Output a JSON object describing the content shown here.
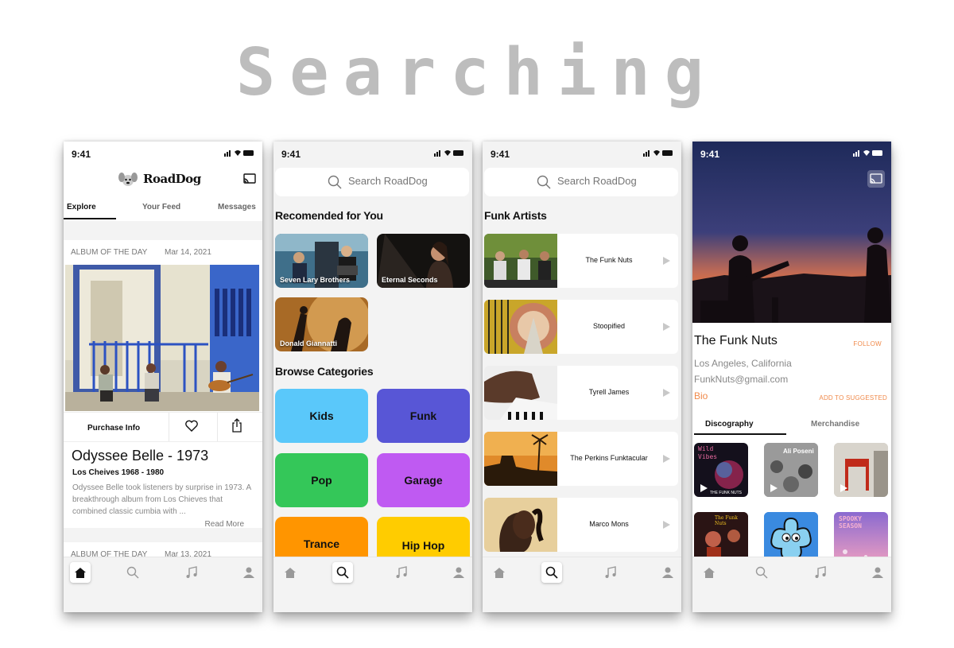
{
  "page_title": "Searching",
  "status": {
    "time": "9:41",
    "icons": "▐▐ ▾ ▬"
  },
  "nav": {
    "home": "home-icon",
    "search": "search-icon",
    "music": "music-note-icon",
    "profile": "profile-icon"
  },
  "explore": {
    "app_name": "RoadDog",
    "tabs": [
      "Explore",
      "Your Feed",
      "Messages"
    ],
    "card": {
      "label": "ALBUM OF THE DAY",
      "date": "Mar 14, 2021",
      "purchase": "Purchase Info",
      "album_title": "Odyssee Belle  - 1973",
      "artist_line": "Los Cheives  1968 - 1980",
      "description": "Odyssee Belle took listeners by surprise in 1973. A breakthrough album from Los Chieves that combined classic cumbia with ...",
      "read_more": "Read More"
    },
    "next_card": {
      "label": "ALBUM OF THE DAY",
      "date": "Mar 13, 2021"
    }
  },
  "search": {
    "placeholder": "Search RoadDog",
    "recommended_heading": "Recomended for You",
    "recommended": [
      "Seven Lary Brothers",
      "Eternal Seconds",
      "Donald Giannatti"
    ],
    "categories_heading": "Browse Categories",
    "categories": [
      {
        "label": "Kids",
        "color": "#5ac8fa"
      },
      {
        "label": "Funk",
        "color": "#5856d6"
      },
      {
        "label": "Pop",
        "color": "#34c759"
      },
      {
        "label": "Garage",
        "color": "#bf5af2"
      },
      {
        "label": "Trance",
        "color": "#ff9500"
      },
      {
        "label": "Hip Hop",
        "color": "#ffcc00"
      }
    ]
  },
  "funk": {
    "placeholder": "Search RoadDog",
    "heading": "Funk Artists",
    "artists": [
      "The Funk Nuts",
      "Stoopified",
      "Tyrell James",
      "The Perkins Funktacular",
      "Marco Mons"
    ]
  },
  "artist_page": {
    "name": "The Funk Nuts",
    "follow": "FOLLOW",
    "location": "Los Angeles, California",
    "email": "FunkNuts@gmail.com",
    "bio": "Bio",
    "add_suggested": "ADD TO SUGGESTED",
    "tabs": [
      "Discography",
      "Merchandise"
    ],
    "album_texts": [
      "Wild Vibes",
      "THE FUNK NUTS",
      "Ali Poseni",
      "The Funk Nuts",
      "SPOOKY SEASON"
    ]
  },
  "colors": {
    "accent": "#f08a4b",
    "title_gray": "#bdbdbd"
  }
}
